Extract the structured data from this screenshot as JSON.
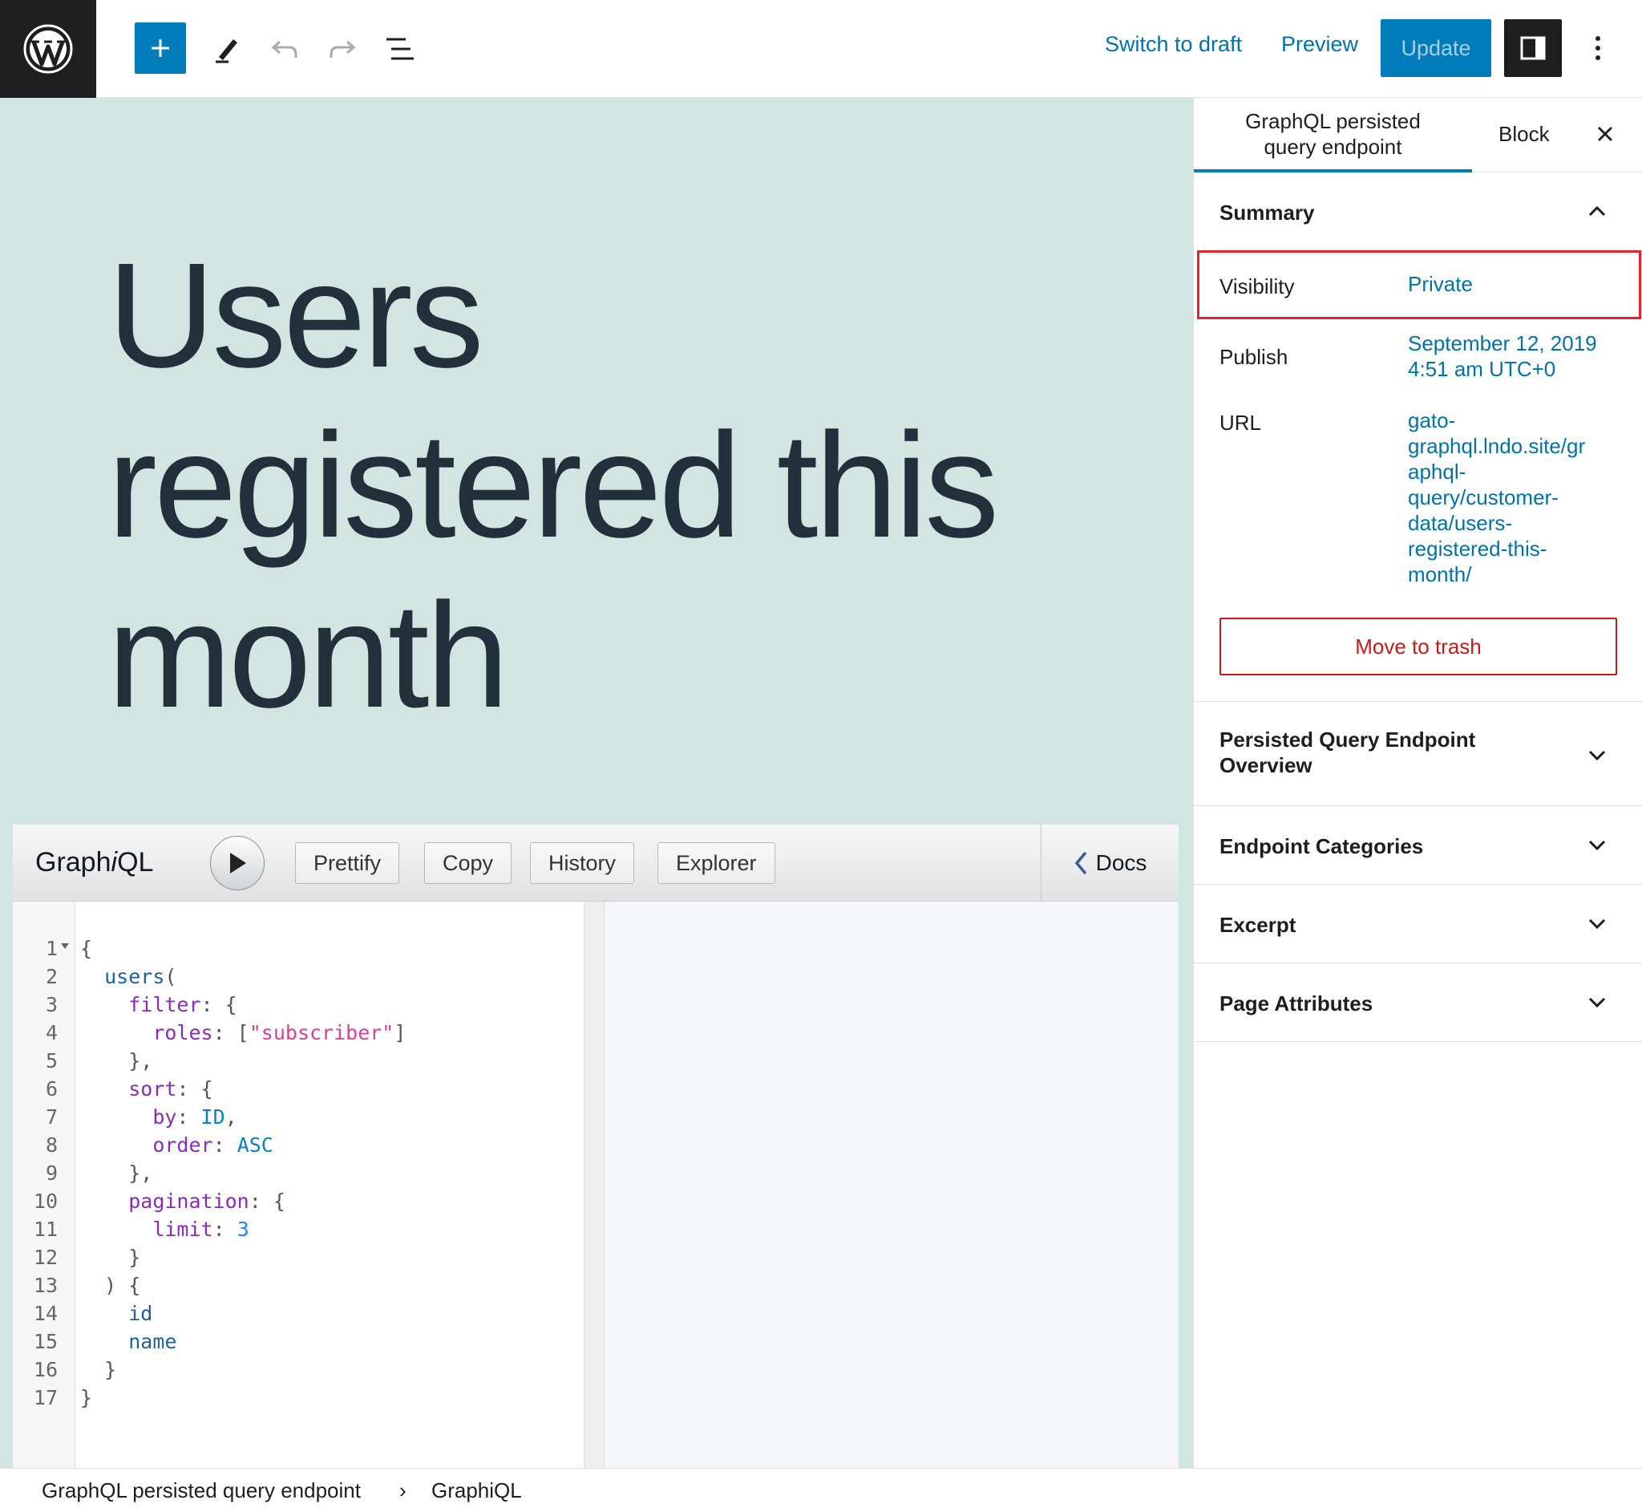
{
  "topbar": {
    "switch_to_draft": "Switch to draft",
    "preview": "Preview",
    "update": "Update"
  },
  "editor": {
    "title_line1": "Users",
    "title_line2": "registered this",
    "title_line3": "month"
  },
  "graphiql": {
    "title_pre": "Graph",
    "title_i": "i",
    "title_post": "QL",
    "buttons": {
      "prettify": "Prettify",
      "copy": "Copy",
      "history": "History",
      "explorer": "Explorer"
    },
    "docs": "Docs",
    "line_numbers": [
      "1",
      "2",
      "3",
      "4",
      "5",
      "6",
      "7",
      "8",
      "9",
      "10",
      "11",
      "12",
      "13",
      "14",
      "15",
      "16",
      "17"
    ]
  },
  "breadcrumb": {
    "item1": "GraphQL persisted query endpoint",
    "separator": "›",
    "item2": "GraphiQL"
  },
  "sidebar": {
    "tab_document_line1": "GraphQL persisted",
    "tab_document_line2": "query endpoint",
    "tab_block": "Block",
    "summary": {
      "heading": "Summary",
      "visibility_label": "Visibility",
      "visibility_value": "Private",
      "publish_label": "Publish",
      "publish_value_line1": "September 12, 2019",
      "publish_value_line2": "4:51 am UTC+0",
      "url_label": "URL",
      "url_lines": [
        "gato-",
        "graphql.lndo.site/gr",
        "aphql-",
        "query/customer-",
        "data/users-",
        "registered-this-",
        "month/"
      ],
      "trash": "Move to trash"
    },
    "panels": {
      "overview_line1": "Persisted Query Endpoint",
      "overview_line2": "Overview",
      "categories": "Endpoint Categories",
      "excerpt": "Excerpt",
      "page_attributes": "Page Attributes"
    }
  },
  "colors": {
    "accent": "#007cba",
    "canvas_bg": "#d2e5e0",
    "highlight": "#e8242a",
    "danger": "#cc1818"
  }
}
